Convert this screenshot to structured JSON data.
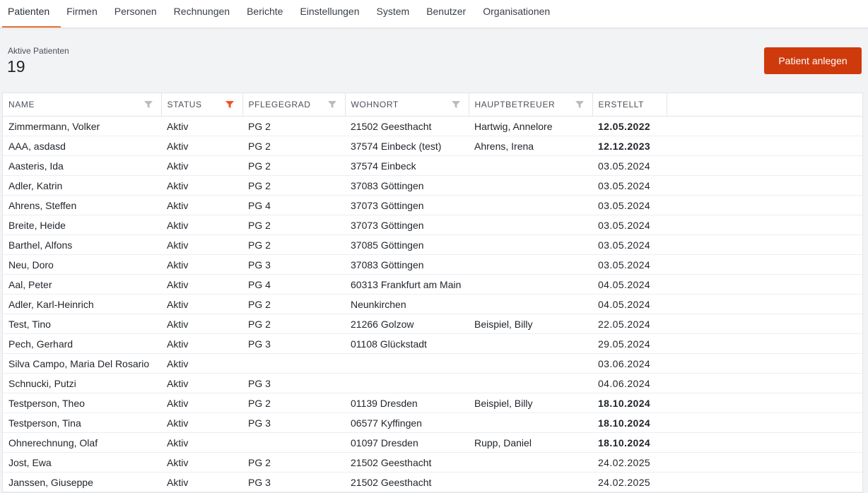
{
  "nav": {
    "tabs": [
      {
        "label": "Patienten",
        "active": true
      },
      {
        "label": "Firmen"
      },
      {
        "label": "Personen"
      },
      {
        "label": "Rechnungen"
      },
      {
        "label": "Berichte"
      },
      {
        "label": "Einstellungen"
      },
      {
        "label": "System"
      },
      {
        "label": "Benutzer"
      },
      {
        "label": "Organisationen"
      }
    ]
  },
  "summary": {
    "label": "Aktive Patienten",
    "count": "19"
  },
  "actions": {
    "new_patient_label": "Patient anlegen"
  },
  "colors": {
    "accent": "#e8712f",
    "primary_button": "#cf3a0c",
    "filter_active": "#f4511e",
    "filter_inactive": "#b8bcc2"
  },
  "table": {
    "columns": [
      {
        "label": "Name",
        "filter_icon": "filter-icon",
        "filter_active": false
      },
      {
        "label": "Status",
        "filter_icon": "filter-icon",
        "filter_active": true
      },
      {
        "label": "Pflegegrad",
        "filter_icon": "filter-icon",
        "filter_active": false
      },
      {
        "label": "Wohnort",
        "filter_icon": "filter-icon",
        "filter_active": false
      },
      {
        "label": "Hauptbetreuer",
        "filter_icon": "filter-icon",
        "filter_active": false
      },
      {
        "label": "Erstellt"
      }
    ],
    "rows": [
      {
        "name": "Zimmermann, Volker",
        "status": "Aktiv",
        "pflegegrad": "PG 2",
        "wohnort": "21502 Geesthacht",
        "betreuer": "Hartwig, Annelore",
        "erstellt": "12.05.2022",
        "bold": true
      },
      {
        "name": "AAA, asdasd",
        "status": "Aktiv",
        "pflegegrad": "PG 2",
        "wohnort": "37574 Einbeck (test)",
        "betreuer": "Ahrens, Irena",
        "erstellt": "12.12.2023",
        "bold": true
      },
      {
        "name": "Aasteris, Ida",
        "status": "Aktiv",
        "pflegegrad": "PG 2",
        "wohnort": "37574 Einbeck",
        "betreuer": "",
        "erstellt": "03.05.2024",
        "bold": false
      },
      {
        "name": "Adler, Katrin",
        "status": "Aktiv",
        "pflegegrad": "PG 2",
        "wohnort": "37083 Göttingen",
        "betreuer": "",
        "erstellt": "03.05.2024",
        "bold": false
      },
      {
        "name": "Ahrens, Steffen",
        "status": "Aktiv",
        "pflegegrad": "PG 4",
        "wohnort": "37073 Göttingen",
        "betreuer": "",
        "erstellt": "03.05.2024",
        "bold": false
      },
      {
        "name": "Breite, Heide",
        "status": "Aktiv",
        "pflegegrad": "PG 2",
        "wohnort": "37073 Göttingen",
        "betreuer": "",
        "erstellt": "03.05.2024",
        "bold": false
      },
      {
        "name": "Barthel, Alfons",
        "status": "Aktiv",
        "pflegegrad": "PG 2",
        "wohnort": "37085 Göttingen",
        "betreuer": "",
        "erstellt": "03.05.2024",
        "bold": false
      },
      {
        "name": "Neu, Doro",
        "status": "Aktiv",
        "pflegegrad": "PG 3",
        "wohnort": "37083 Göttingen",
        "betreuer": "",
        "erstellt": "03.05.2024",
        "bold": false
      },
      {
        "name": "Aal, Peter",
        "status": "Aktiv",
        "pflegegrad": "PG 4",
        "wohnort": "60313 Frankfurt am Main",
        "betreuer": "",
        "erstellt": "04.05.2024",
        "bold": false
      },
      {
        "name": "Adler, Karl-Heinrich",
        "status": "Aktiv",
        "pflegegrad": "PG 2",
        "wohnort": "Neunkirchen",
        "betreuer": "",
        "erstellt": "04.05.2024",
        "bold": false
      },
      {
        "name": "Test, Tino",
        "status": "Aktiv",
        "pflegegrad": "PG 2",
        "wohnort": "21266 Golzow",
        "betreuer": "Beispiel, Billy",
        "erstellt": "22.05.2024",
        "bold": false
      },
      {
        "name": "Pech, Gerhard",
        "status": "Aktiv",
        "pflegegrad": "PG 3",
        "wohnort": "01108 Glückstadt",
        "betreuer": "",
        "erstellt": "29.05.2024",
        "bold": false
      },
      {
        "name": "Silva Campo, Maria Del Rosario",
        "status": "Aktiv",
        "pflegegrad": "",
        "wohnort": "",
        "betreuer": "",
        "erstellt": "03.06.2024",
        "bold": false
      },
      {
        "name": "Schnucki, Putzi",
        "status": "Aktiv",
        "pflegegrad": "PG 3",
        "wohnort": "",
        "betreuer": "",
        "erstellt": "04.06.2024",
        "bold": false
      },
      {
        "name": "Testperson, Theo",
        "status": "Aktiv",
        "pflegegrad": "PG 2",
        "wohnort": "01139 Dresden",
        "betreuer": "Beispiel, Billy",
        "erstellt": "18.10.2024",
        "bold": true
      },
      {
        "name": "Testperson, Tina",
        "status": "Aktiv",
        "pflegegrad": "PG 3",
        "wohnort": "06577 Kyffingen",
        "betreuer": "",
        "erstellt": "18.10.2024",
        "bold": true
      },
      {
        "name": "Ohnerechnung, Olaf",
        "status": "Aktiv",
        "pflegegrad": "",
        "wohnort": "01097 Dresden",
        "betreuer": "Rupp, Daniel",
        "erstellt": "18.10.2024",
        "bold": true
      },
      {
        "name": "Jost, Ewa",
        "status": "Aktiv",
        "pflegegrad": "PG 2",
        "wohnort": "21502 Geesthacht",
        "betreuer": "",
        "erstellt": "24.02.2025",
        "bold": false
      },
      {
        "name": "Janssen, Giuseppe",
        "status": "Aktiv",
        "pflegegrad": "PG 3",
        "wohnort": "21502 Geesthacht",
        "betreuer": "",
        "erstellt": "24.02.2025",
        "bold": false
      }
    ]
  }
}
